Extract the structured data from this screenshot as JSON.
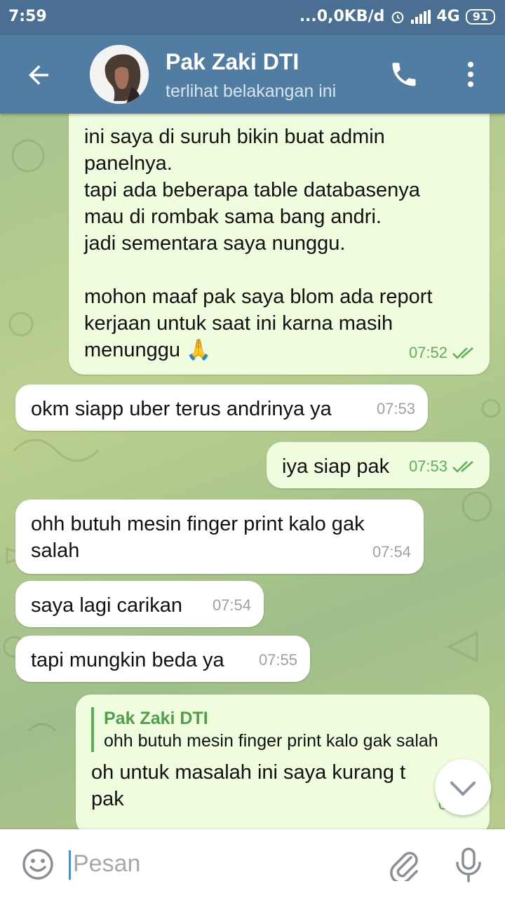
{
  "status_bar": {
    "time": "7:59",
    "network_speed": "...0,0KB/d",
    "network_type": "4G",
    "battery": "91"
  },
  "header": {
    "title": "Pak Zaki DTI",
    "subtitle": "terlihat belakangan ini",
    "back_icon": "arrow-left-icon",
    "call_icon": "phone-icon",
    "menu_icon": "more-vert-icon"
  },
  "messages": [
    {
      "direction": "out",
      "text": "ini saya di suruh bikin buat admin\npanelnya.\ntapi ada beberapa table databasenya\nmau di rombak sama bang andri.\njadi sementara saya nunggu.\n\nmohon maaf pak saya blom ada report\nkerjaan untuk saat ini karna masih\nmenunggu 🙏",
      "time": "07:52",
      "read": true
    },
    {
      "direction": "in",
      "text": "okm siapp uber terus andrinya ya",
      "time": "07:53"
    },
    {
      "direction": "out",
      "text": "iya siap pak",
      "time": "07:53",
      "read": true
    },
    {
      "direction": "in",
      "text": "ohh butuh mesin finger print kalo gak\nsalah",
      "time": "07:54"
    },
    {
      "direction": "in",
      "text": "saya lagi carikan",
      "time": "07:54"
    },
    {
      "direction": "in",
      "text": "tapi mungkin beda ya",
      "time": "07:55"
    },
    {
      "direction": "out",
      "quote_name": "Pak Zaki DTI",
      "quote_text": "ohh butuh mesin finger print kalo gak salah",
      "text": "oh untuk masalah ini saya kurang t\npak",
      "time": "07:55"
    }
  ],
  "input": {
    "placeholder": "Pesan"
  },
  "colors": {
    "header": "#527da3",
    "status_bar": "#4a6f92",
    "outgoing_bubble": "#effdde",
    "incoming_bubble": "#ffffff",
    "read_check": "#5fae5a"
  }
}
